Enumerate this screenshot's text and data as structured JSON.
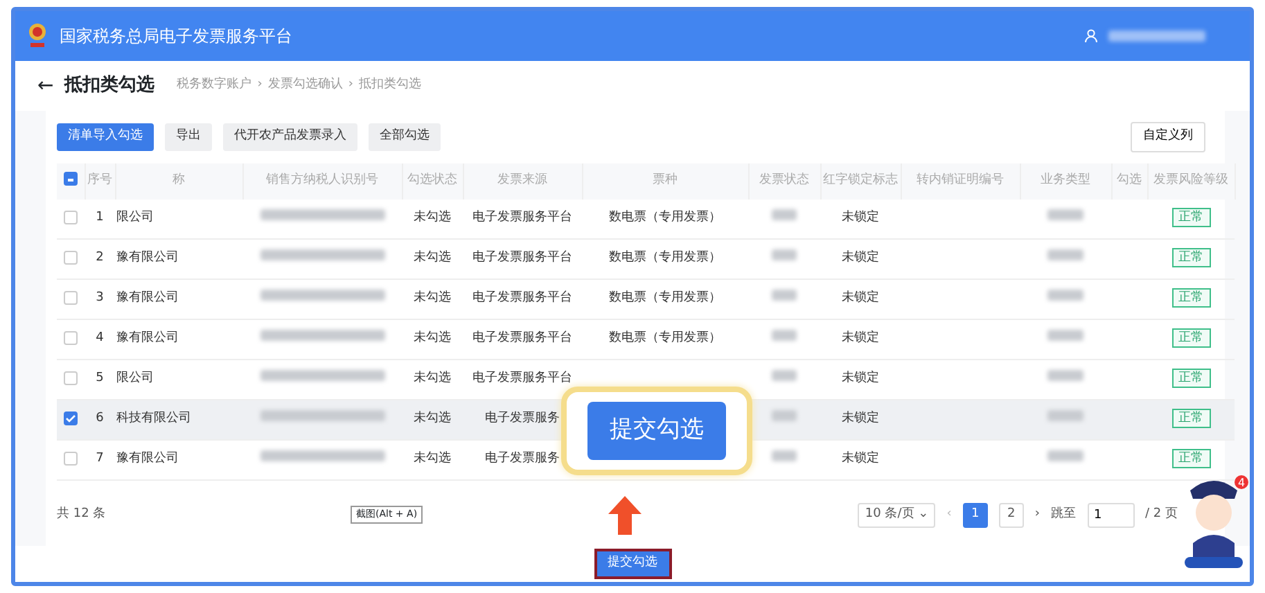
{
  "app_title": "国家税务总局电子发票服务平台",
  "page_title": "抵扣类勾选",
  "back_icon": "←",
  "breadcrumb": [
    "税务数字账户",
    "发票勾选确认",
    "抵扣类勾选"
  ],
  "breadcrumb_separator": "›",
  "toolbar": [
    {
      "label": "清单导入勾选",
      "primary": true
    },
    {
      "label": "导出",
      "primary": false
    },
    {
      "label": "代开农产品发票录入",
      "primary": false
    },
    {
      "label": "全部勾选",
      "primary": false
    }
  ],
  "customize_button": "自定义列",
  "table": {
    "header_indeterminate": true,
    "columns": [
      "序号",
      "称",
      "销售方纳税人识别号",
      "勾选状态",
      "发票来源",
      "票种",
      "发票状态",
      "红字锁定标志",
      "转内销证明编号",
      "业务类型",
      "勾选",
      "发票风险等级"
    ],
    "rows": [
      {
        "no": "1",
        "name": "限公司",
        "status": "未勾选",
        "source": "电子发票服务平台",
        "type": "数电票（专用发票）",
        "lock": "未锁定",
        "risk": "正常",
        "selected": false
      },
      {
        "no": "2",
        "name": "豫有限公司",
        "status": "未勾选",
        "source": "电子发票服务平台",
        "type": "数电票（专用发票）",
        "lock": "未锁定",
        "risk": "正常",
        "selected": false
      },
      {
        "no": "3",
        "name": "豫有限公司",
        "status": "未勾选",
        "source": "电子发票服务平台",
        "type": "数电票（专用发票）",
        "lock": "未锁定",
        "risk": "正常",
        "selected": false
      },
      {
        "no": "4",
        "name": "豫有限公司",
        "status": "未勾选",
        "source": "电子发票服务平台",
        "type": "数电票（专用发票）",
        "lock": "未锁定",
        "risk": "正常",
        "selected": false
      },
      {
        "no": "5",
        "name": "限公司",
        "status": "未勾选",
        "source": "电子发票服务平台",
        "lock": "未锁定",
        "risk": "正常",
        "selected": false
      },
      {
        "no": "6",
        "name": "科技有限公司",
        "status": "未勾选",
        "source": "电子发票服务",
        "lock": "未锁定",
        "risk": "正常",
        "selected": true
      },
      {
        "no": "7",
        "name": "豫有限公司",
        "status": "未勾选",
        "source": "电子发票服务",
        "lock": "未锁定",
        "risk": "正常",
        "selected": false
      }
    ]
  },
  "footer": {
    "total": "共 12 条",
    "tooltip": "截图(Alt + A)",
    "page_size": "10 条/页",
    "page_size_caret": "⌄",
    "prev": "‹",
    "next": "›",
    "pages": [
      {
        "label": "1",
        "selected": true
      },
      {
        "label": "2",
        "selected": false
      }
    ],
    "jump_label": "跳至",
    "jump_value": "1",
    "page_count": "/ 2 页"
  },
  "callout_button": "提交勾选",
  "submit_button": "提交勾选",
  "mascot_badge": "4"
}
